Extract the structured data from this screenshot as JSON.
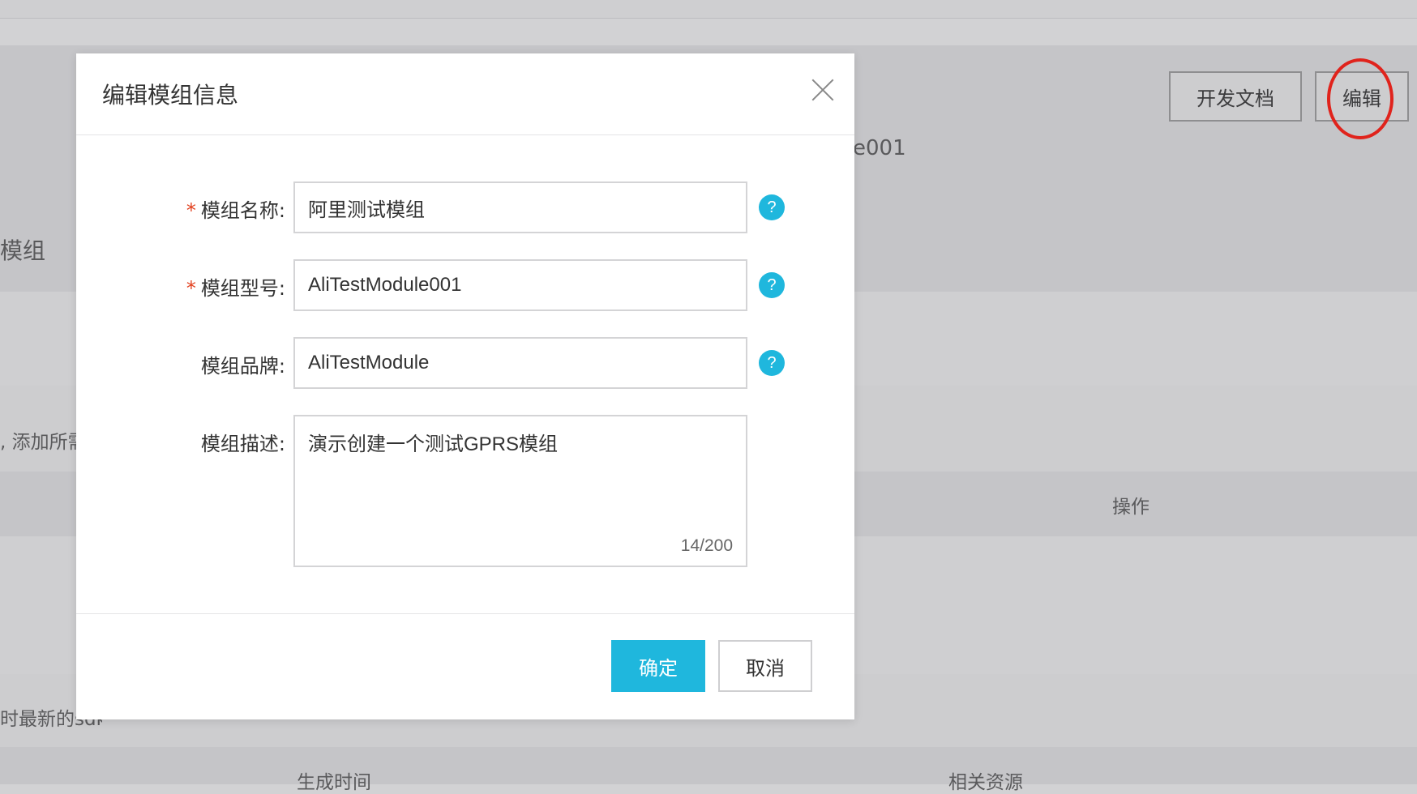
{
  "background": {
    "dev_docs_button": "开发文档",
    "edit_button": "编辑",
    "model_partial": "e001",
    "module_partial": "模组",
    "hint_partial": ", 添加所需",
    "ops_header": "操作",
    "sdk_partial": "时最新的sdk",
    "gen_time_header": "生成时间",
    "related_header": "相关资源"
  },
  "modal": {
    "title": "编辑模组信息",
    "fields": {
      "name": {
        "label": "模组名称:",
        "required": "*",
        "value": "阿里测试模组"
      },
      "model": {
        "label": "模组型号:",
        "required": "*",
        "value": "AliTestModule001"
      },
      "brand": {
        "label": "模组品牌:",
        "value": "AliTestModule"
      },
      "desc": {
        "label": "模组描述:",
        "value": "演示创建一个测试GPRS模组",
        "count": "14/200"
      }
    },
    "help_glyph": "?",
    "confirm_label": "确定",
    "cancel_label": "取消"
  },
  "colors": {
    "accent": "#1fb7dd",
    "required": "#e2411f",
    "highlight_circle": "#e0231c"
  }
}
